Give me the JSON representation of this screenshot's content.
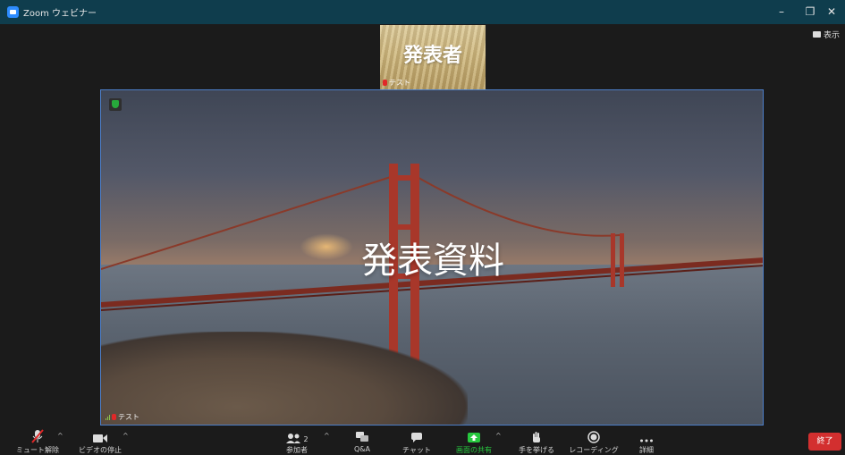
{
  "window": {
    "title": "Zoom ウェビナー",
    "minimize": "–",
    "restore": "❐",
    "close": "✕"
  },
  "view_button": {
    "label": "表示"
  },
  "speaker": {
    "label": "発表者",
    "name": "テスト"
  },
  "share": {
    "title": "発表資料",
    "name": "テスト"
  },
  "toolbar": {
    "mute_label": "ミュート解除",
    "video_label": "ビデオの停止",
    "participants_label": "参加者",
    "participants_count": "2",
    "qa_label": "Q&A",
    "chat_label": "チャット",
    "share_label": "画面の共有",
    "raise_hand_label": "手を挙げる",
    "record_label": "レコーディング",
    "more_label": "詳細",
    "end_label": "終了"
  },
  "colors": {
    "titlebar": "#0f3d4d",
    "share_border": "#4d7fc9",
    "end": "#d32f2f",
    "share_green": "#27c93f",
    "muted_red": "#e02828"
  }
}
